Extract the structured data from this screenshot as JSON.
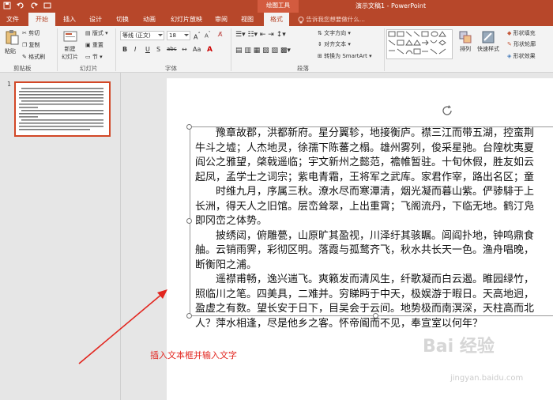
{
  "window": {
    "title": "演示文稿1 - PowerPoint",
    "contextual_tab_group": "绘图工具"
  },
  "tabs": [
    "文件",
    "开始",
    "插入",
    "设计",
    "切换",
    "动画",
    "幻灯片放映",
    "审阅",
    "视图",
    "格式"
  ],
  "active_tab": "开始",
  "tell_me": "告诉我您想要做什么...",
  "ribbon": {
    "clipboard": {
      "paste": "粘贴",
      "cut": "剪切",
      "copy": "复制",
      "format_painter": "格式刷",
      "label": "剪贴板"
    },
    "slides": {
      "new_slide": "新建",
      "new_slide_2": "幻灯片",
      "layout": "版式",
      "reset": "重置",
      "section": "节",
      "label": "幻灯片"
    },
    "font": {
      "name": "等线 (正文)",
      "size": "18",
      "label": "字体",
      "bold": "B",
      "italic": "I",
      "underline": "U",
      "strike": "S",
      "shadow": "abc"
    },
    "paragraph": {
      "label": "段落",
      "text_direction": "文字方向",
      "align_text": "对齐文本",
      "smartart": "转换为 SmartArt"
    },
    "drawing": {
      "arrange": "排列",
      "quick_styles": "快速样式",
      "shape_fill": "形状填充",
      "shape_outline": "形状轮廓",
      "shape_effects": "形状效果"
    }
  },
  "thumbnail": {
    "number": "1"
  },
  "slide_text": [
    "　　豫章故郡，洪都新府。星分翼轸，地接衡庐。襟三江而带五湖，控蛮荆",
    "牛斗之墟；人杰地灵，徐孺下陈蕃之榻。雄州雾列，俊采星驰。台隍枕夷夏",
    "阎公之雅望，棨戟遥临；宇文新州之懿范，襜帷暂驻。十旬休假，胜友如云",
    "起凤，孟学士之词宗；紫电青霜，王将军之武库。家君作宰，路出名区；童",
    "　　时维九月，序属三秋。潦水尽而寒潭清，烟光凝而暮山紫。俨骖騑于上",
    "长洲，得天人之旧馆。层峦耸翠，上出重霄；飞阁流丹，下临无地。鹤汀凫",
    "即冈峦之体势。",
    "　　披绣闼，俯雕甍，山原旷其盈视，川泽纡其骇瞩。闾阎扑地，钟鸣鼎食",
    "舳。云销雨霁，彩彻区明。落霞与孤鹜齐飞，秋水共长天一色。渔舟唱晚，",
    "断衡阳之浦。",
    "　　遥襟甫畅，逸兴遄飞。爽籁发而清风生，纤歌凝而白云遏。睢园绿竹，",
    "照临川之笔。四美具，二难并。穷睇眄于中天，极娱游于暇日。天高地迥，",
    "盈虚之有数。望长安于日下，目吴会于云间。地势极而南溟深，天柱高而北",
    "人？萍水相逢，尽是他乡之客。怀帝阍而不见，奉宣室以何年？"
  ],
  "annotation": "插入文本框并输入文字",
  "watermark": {
    "logo": "Bai 经验",
    "url": "jingyan.baidu.com"
  },
  "colors": {
    "accent": "#b7472a",
    "annotation": "#e2261f"
  }
}
